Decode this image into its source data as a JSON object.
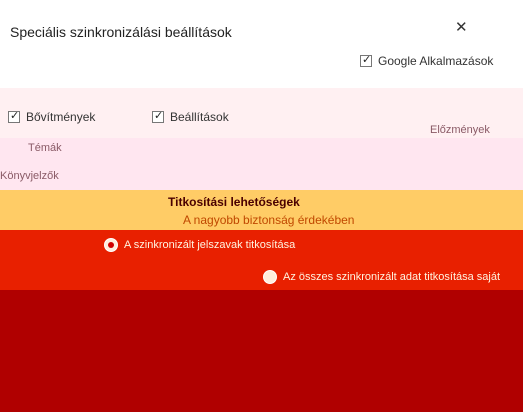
{
  "dialog": {
    "title": "Speciális szinkronizálási beállítások",
    "close_icon": "close-icon"
  },
  "sync_items": [
    {
      "label": "Bővítmények",
      "checked": true
    },
    {
      "label": "Beállítások",
      "checked": true
    },
    {
      "label": "Google Alkalmazások",
      "checked": true
    },
    {
      "label": "Témák",
      "checked": false
    },
    {
      "label": "Előzmények",
      "checked": false
    },
    {
      "label": "Könyvjelzők",
      "checked": false
    }
  ],
  "encryption": {
    "title": "Titkosítási lehetőségek",
    "subtitle": "A nagyobb biztonság érdekében",
    "option_1": "A szinkronizált jelszavak titkosítása",
    "option_2": "Az összes szinkronizált adat titkosítása saját"
  },
  "colors": {
    "accent": "#b00000",
    "orange": "#ffcc66"
  }
}
